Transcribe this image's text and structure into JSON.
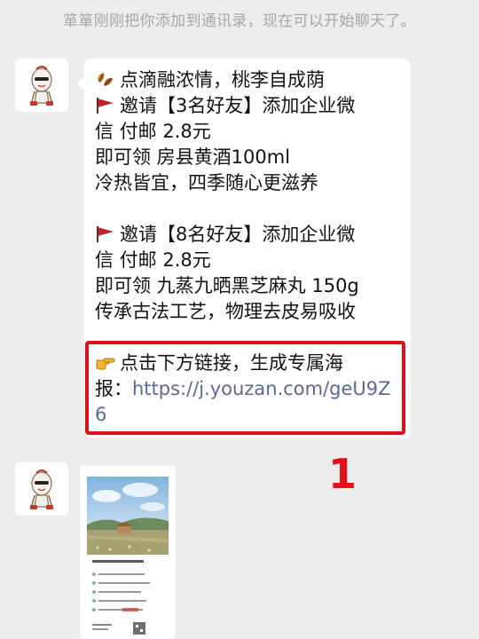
{
  "system_notice": "箪箪刚刚把你添加到通讯录，现在可以开始聊天了。",
  "message": {
    "line1": "点滴融浓情，桃李自成荫",
    "line2": "邀请【3名好友】添加企业微",
    "line3": "信 付邮 2.8元",
    "line4": "即可领  房县黄酒100ml",
    "line5": "冷热皆宜，四季随心更滋养",
    "line6": "邀请【8名好友】添加企业微",
    "line7": "信 付邮 2.8元",
    "line8": "即可领  九蒸九晒黑芝麻丸 150g",
    "line9": "传承古法工艺，物理去皮易吸收",
    "line10": "点击下方链接，生成专属海",
    "line11_prefix": "报：",
    "link_part1": "https://j.youzan.com/geU9Z",
    "link_part2": "6"
  },
  "annotation_number": "1",
  "icons": {
    "leaves": "autumn-leaves-icon",
    "flag": "red-flag-icon",
    "pointer": "pointing-hand-icon",
    "avatar": "mascot-avatar-icon"
  },
  "colors": {
    "background": "#ededed",
    "bubble": "#ffffff",
    "link": "#5b6a94",
    "highlight": "#e10f17",
    "notice_text": "#a6a6a6"
  }
}
